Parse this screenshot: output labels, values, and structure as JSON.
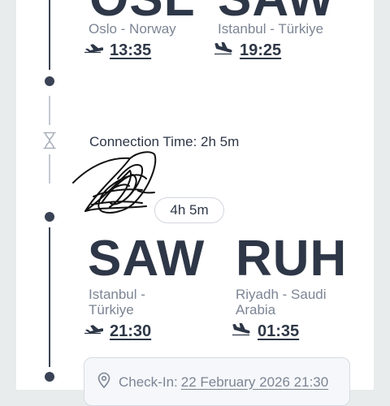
{
  "segment1": {
    "origin": {
      "code": "OSL",
      "city": "Oslo - Norway",
      "time": "13:35"
    },
    "destination": {
      "code": "SAW",
      "city": "Istanbul - Türkiye",
      "time": "19:25"
    }
  },
  "connection": {
    "text": "Connection Time: 2h 5m"
  },
  "segment2": {
    "duration": "4h 5m",
    "origin": {
      "code": "SAW",
      "city_line1": "Istanbul -",
      "city_line2": "Türkiye",
      "time": "21:30"
    },
    "destination": {
      "code": "RUH",
      "city_line1": "Riyadh - Saudi",
      "city_line2": "Arabia",
      "time": "01:35"
    }
  },
  "checkin": {
    "label": "Check-In:",
    "value": "22 February 2026 21:30"
  },
  "colors": {
    "text": "#2e3747",
    "muted": "#7c8594",
    "line": "#3a4355",
    "background": "#e8ecec"
  }
}
